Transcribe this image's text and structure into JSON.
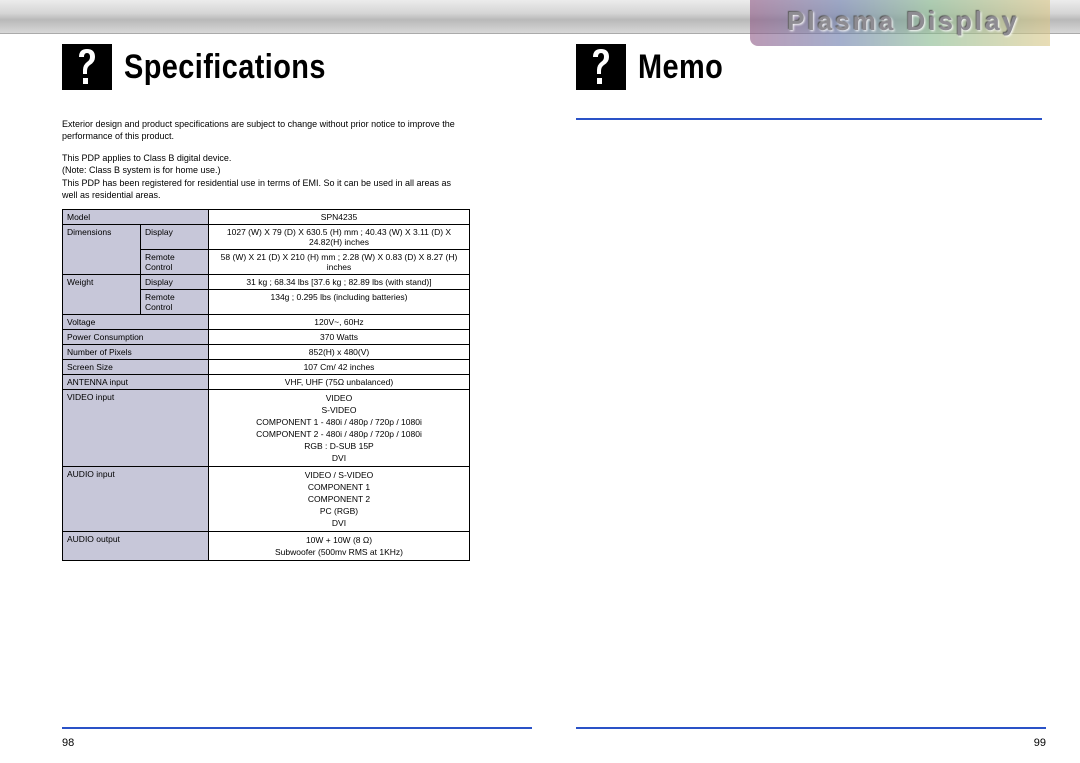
{
  "brand": "Plasma Display",
  "left": {
    "title": "Specifications",
    "intro": "Exterior design and product specifications are subject to change without prior notice to improve the performance of this product.",
    "note": "This PDP applies to Class B digital device.\n(Note: Class B system is for home use.)\nThis PDP has been registered for residential use in terms of EMI. So it can be used in all areas as well as residential areas.",
    "rows": {
      "model_label": "Model",
      "model_value": "SPN4235",
      "dim_label": "Dimensions",
      "dim_display_label": "Display",
      "dim_display_value": "1027 (W) X 79 (D) X 630.5 (H) mm ; 40.43 (W) X 3.11 (D) X 24.82(H) inches",
      "dim_remote_label": "Remote Control",
      "dim_remote_value": "58 (W) X 21 (D) X 210 (H) mm ; 2.28 (W) X 0.83 (D) X 8.27 (H) inches",
      "wt_label": "Weight",
      "wt_display_label": "Display",
      "wt_display_value": "31 kg ; 68.34 lbs [37.6 kg ; 82.89 lbs (with stand)]",
      "wt_remote_label": "Remote Control",
      "wt_remote_value": "134g ; 0.295 lbs (including batteries)",
      "voltage_label": "Voltage",
      "voltage_value": "120V~, 60Hz",
      "power_label": "Power Consumption",
      "power_value": "370 Watts",
      "pixels_label": "Number of Pixels",
      "pixels_value": "852(H) x 480(V)",
      "screen_label": "Screen Size",
      "screen_value": "107 Cm/ 42 inches",
      "antenna_label": "ANTENNA input",
      "antenna_value": "VHF, UHF (75Ω unbalanced)",
      "video_in_label": "VIDEO input",
      "video_in_1": "VIDEO",
      "video_in_2": "S-VIDEO",
      "video_in_3": "COMPONENT 1 - 480i / 480p / 720p / 1080i",
      "video_in_4": "COMPONENT 2 - 480i / 480p / 720p / 1080i",
      "video_in_5": "RGB : D-SUB 15P",
      "video_in_6": "DVI",
      "audio_in_label": "AUDIO input",
      "audio_in_1": "VIDEO / S-VIDEO",
      "audio_in_2": "COMPONENT 1",
      "audio_in_3": "COMPONENT 2",
      "audio_in_4": "PC (RGB)",
      "audio_in_5": "DVI",
      "audio_out_label": "AUDIO output",
      "audio_out_1": "10W + 10W (8 Ω)",
      "audio_out_2": "Subwoofer (500mv RMS at 1KHz)"
    },
    "pagenum": "98"
  },
  "right": {
    "title": "Memo",
    "pagenum": "99"
  }
}
